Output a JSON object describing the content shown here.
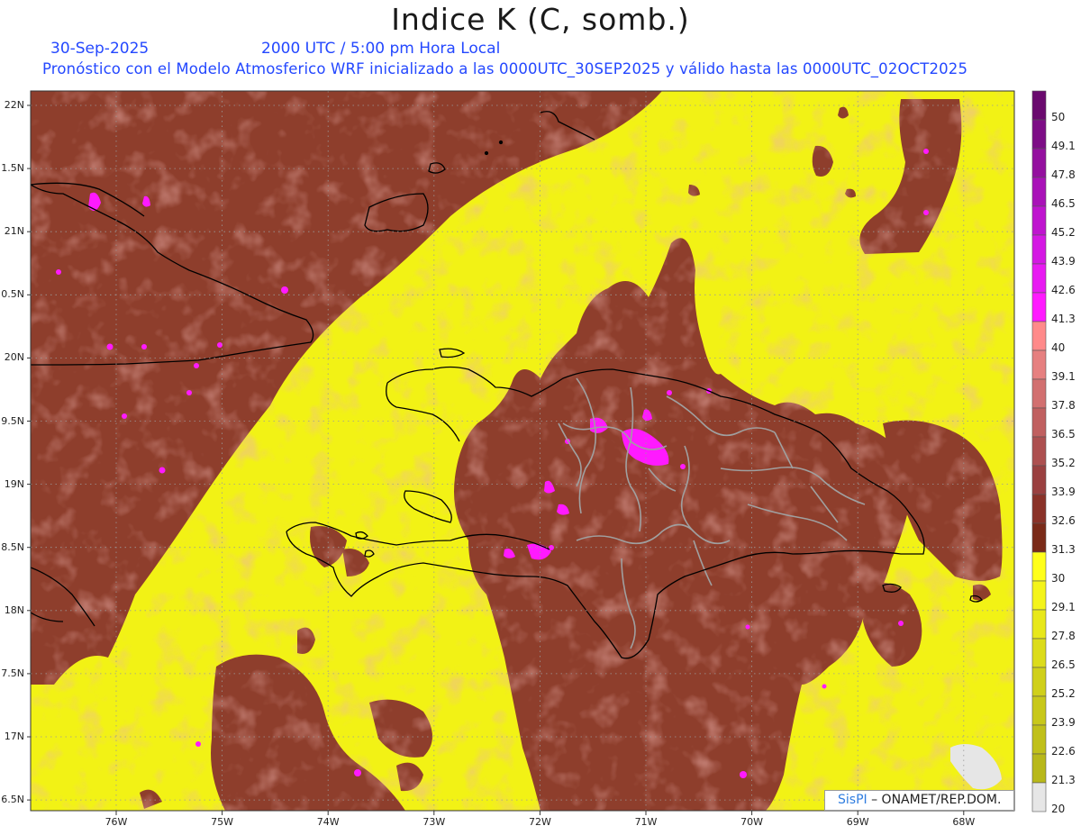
{
  "title": "Indice K (C, somb.)",
  "date": "30-Sep-2025",
  "time": "2000 UTC / 5:00 pm Hora Local",
  "description": "Pronóstico con el Modelo Atmosferico WRF inicializado a las 0000UTC_30SEP2025 y válido hasta las  0000UTC_02OCT2025",
  "lat_labels": [
    "22N",
    "1.5N",
    "21N",
    "0.5N",
    "20N",
    "9.5N",
    "19N",
    "8.5N",
    "18N",
    "7.5N",
    "17N",
    "6.5N"
  ],
  "lon_labels": [
    "76W",
    "75W",
    "74W",
    "73W",
    "72W",
    "71W",
    "70W",
    "69W",
    "68W"
  ],
  "colorbar": {
    "labels": [
      "50",
      "49.1",
      "47.8",
      "46.5",
      "45.2",
      "43.9",
      "42.6",
      "41.3",
      "40",
      "39.1",
      "37.8",
      "36.5",
      "35.2",
      "33.9",
      "32.6",
      "31.3",
      "30",
      "29.1",
      "27.8",
      "26.5",
      "25.2",
      "23.9",
      "22.6",
      "21.3",
      "20"
    ],
    "colors": [
      "#6a0a6e",
      "#7d0d86",
      "#94109f",
      "#a912b8",
      "#bf14cf",
      "#d418e3",
      "#e81af2",
      "#ff1aff",
      "#ff8a8a",
      "#e68080",
      "#d27070",
      "#c06060",
      "#ad5050",
      "#9a4040",
      "#8a3228",
      "#7a2a18",
      "#ffff1a",
      "#f4f41a",
      "#e8e81a",
      "#dcdc1a",
      "#d0d01a",
      "#c8c81a",
      "#c0c01a",
      "#b8b81a",
      "#e6e6e6"
    ]
  },
  "credit": {
    "brand": "SisPI",
    "org": "– ONAMET/REP.DOM."
  },
  "colors": {
    "high": "#8e3e2c",
    "low": "#f2f215",
    "extreme": "#ff1aff",
    "coast": "#000000",
    "provinces": "#a0a0a0"
  }
}
